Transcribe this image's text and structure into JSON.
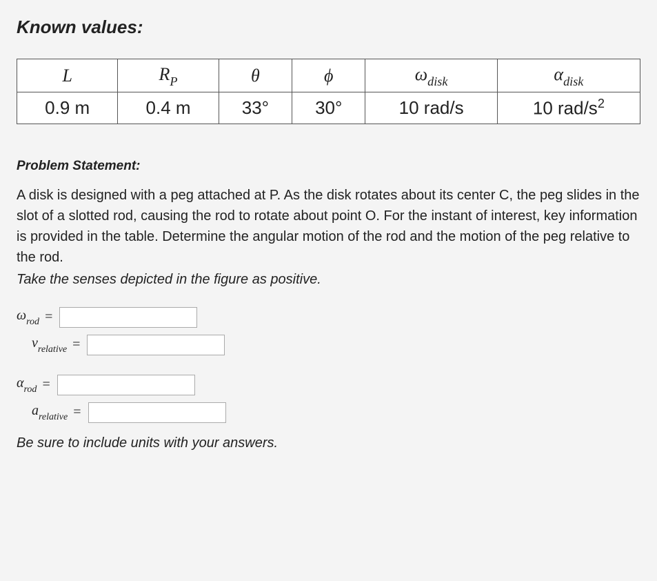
{
  "headings": {
    "known": "Known values:",
    "problem": "Problem Statement:"
  },
  "table": {
    "headers": {
      "L": "L",
      "Rp_base": "R",
      "Rp_sub": "P",
      "theta": "θ",
      "phi": "ϕ",
      "wdisk_base": "ω",
      "wdisk_sub": "disk",
      "adisk_base": "α",
      "adisk_sub": "disk"
    },
    "values": {
      "L": "0.9 m",
      "Rp": "0.4 m",
      "theta": "33°",
      "phi": "30°",
      "wdisk": "10 rad/s",
      "adisk_num": "10 rad/s",
      "adisk_exp": "2"
    }
  },
  "problem": {
    "text": "A disk is designed with a peg attached at P. As the disk rotates about its center C, the peg slides in the slot of a slotted rod, causing the rod to rotate about point O. For the instant of interest, key information is provided in the table. Determine the angular motion of the rod and the motion of the peg relative to the rod.",
    "instruction": "Take the senses depicted in the figure as positive."
  },
  "answers": {
    "wrod_base": "ω",
    "wrod_sub": "rod",
    "vrel_base": "v",
    "vrel_sub": "relative",
    "arod_base": "α",
    "arod_sub": "rod",
    "arel_base": "a",
    "arel_sub": "relative",
    "eq": "="
  },
  "inputs": {
    "wrod": "",
    "vrel": "",
    "arod": "",
    "arel": ""
  },
  "footer": "Be sure to include units with your answers."
}
